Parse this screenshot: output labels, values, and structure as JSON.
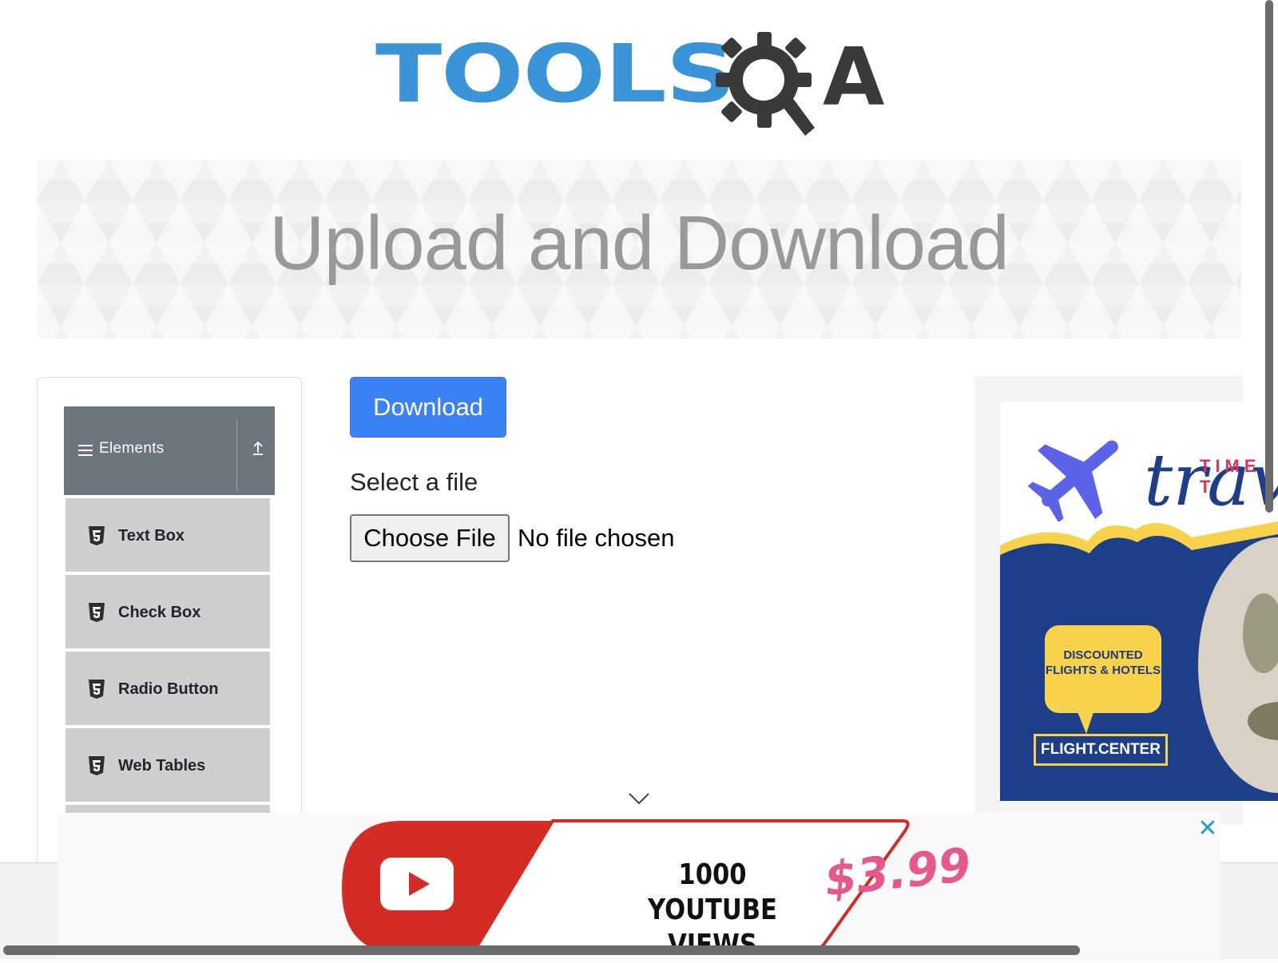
{
  "logo": {
    "text_left": "TOOLS",
    "text_right": "A",
    "alt": "TOOLSQA"
  },
  "banner": {
    "title": "Upload and Download"
  },
  "sidebar": {
    "group_title": "Elements",
    "items": [
      {
        "label": "Text Box",
        "icon": "html5-icon"
      },
      {
        "label": "Check Box",
        "icon": "html5-icon"
      },
      {
        "label": "Radio Button",
        "icon": "html5-icon"
      },
      {
        "label": "Web Tables",
        "icon": "html5-icon"
      }
    ]
  },
  "main": {
    "download_label": "Download",
    "select_label": "Select a file",
    "choose_file_label": "Choose File",
    "no_file_text": "No file chosen"
  },
  "right_ad": {
    "time_text": "TIME T",
    "travel_text": "trav",
    "bubble_text": "DISCOUNTED FLIGHTS & HOTELS",
    "brand": "FLIGHT.CENTER"
  },
  "bottom_ad": {
    "line1": "1000",
    "line2": "YOUTUBE VIEWS",
    "price": "$3.99",
    "close": "✕"
  },
  "colors": {
    "primary": "#3b82f6",
    "logo_blue": "#3a94d8",
    "nav_header": "#6c757d",
    "nav_item": "#cfcfcf",
    "ad_navy": "#1d3f8a",
    "ad_yellow": "#f7d24a",
    "yt_red": "#d32f2f"
  }
}
